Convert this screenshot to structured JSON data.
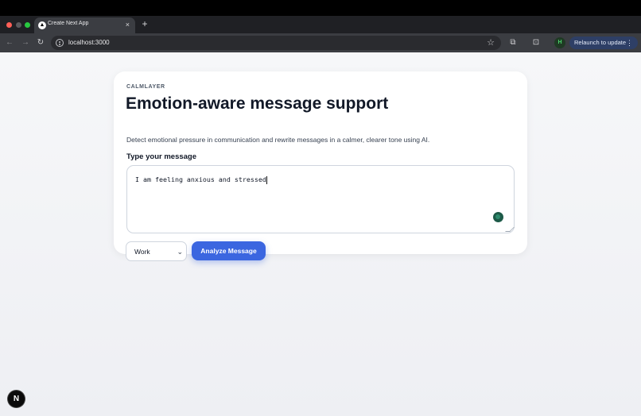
{
  "browser": {
    "tab_title": "Create Next App",
    "tab_favicon": "next-logo",
    "tab_close": "×",
    "new_tab": "+",
    "back": "←",
    "forward": "→",
    "reload": "↻",
    "url": "localhost:3000",
    "bookmark_star": "☆",
    "extensions": "⧉",
    "side_panel": "⊡",
    "profile_initial": "H",
    "relaunch_label": "Relaunch to update",
    "menu": "⋮"
  },
  "card": {
    "eyebrow": "CALMLAYER",
    "title": "Emotion-aware message support",
    "subtitle": "Detect emotional pressure in communication and rewrite messages in a calmer, clearer tone using AI.",
    "field_label": "Type your message",
    "message_value": "I am feeling anxious and stressed",
    "context_select": {
      "selected": "Work",
      "chevron": "⌄"
    },
    "analyze_button": "Analyze Message"
  },
  "dev_badge": "N",
  "colors": {
    "accent": "#3b66e0",
    "page_bg": "#f4f5f8",
    "card_bg": "#ffffff",
    "title_text": "#111827"
  }
}
